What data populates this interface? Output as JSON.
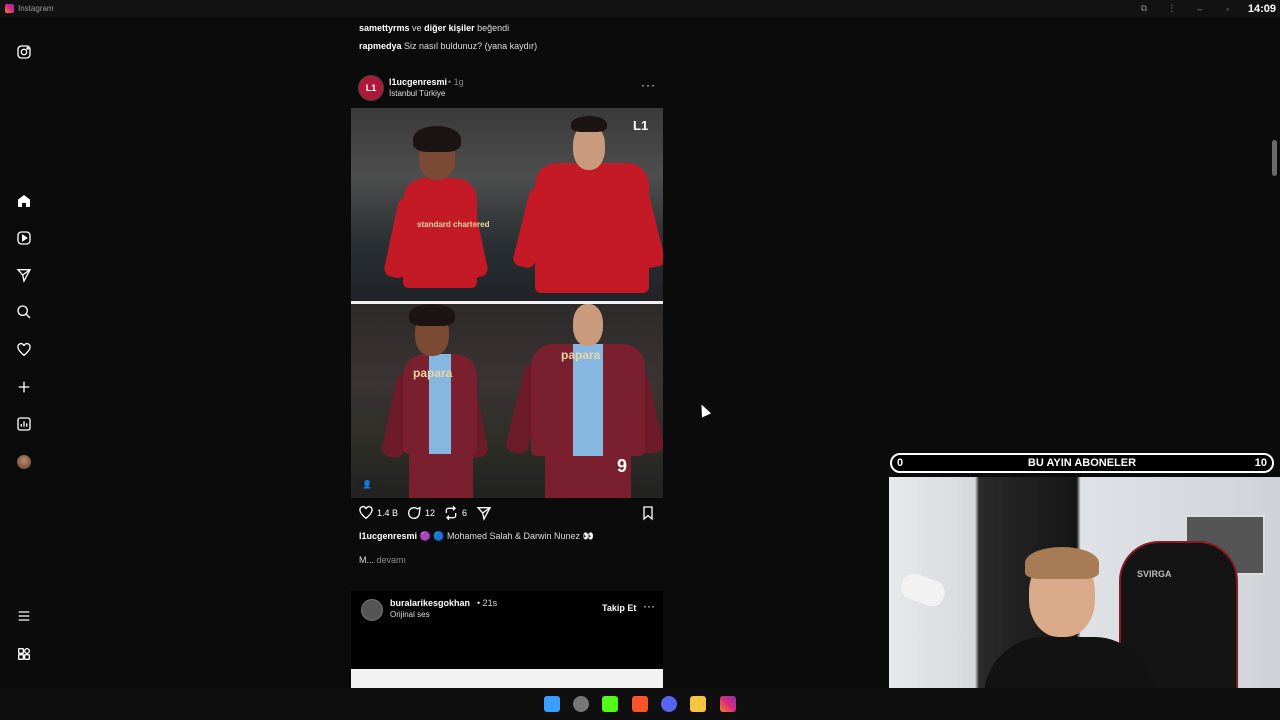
{
  "window": {
    "title": "Instagram",
    "clock": "14:09"
  },
  "feed": {
    "likes_line": {
      "user": "samettyrms",
      "connector": "ve",
      "others": "diğer kişiler",
      "verb": "beğendi"
    },
    "comment_line": {
      "user": "rapmedya",
      "text": "Siz nasıl buldunuz? (yana kaydır)"
    },
    "post": {
      "user": "l1ucgenresmi",
      "time": "1g",
      "location": "İstanbul Türkiye",
      "avatar_text": "L1",
      "image_logo": "L1",
      "sponsor_top": "standard chartered",
      "sponsor_bottom": "papara",
      "shirt_number": "9",
      "likes": "1.4 B",
      "comments": "12",
      "reposts": "6",
      "caption_user": "l1ucgenresmi",
      "caption_text": "🟣 🔵 Mohamed Salah & Darwin Nunez 👀",
      "caption_truncated": "M...",
      "more_label": "devamı"
    },
    "post2": {
      "user": "buralarikesgokhan",
      "time": "21s",
      "audio": "Orijinal ses",
      "follow_label": "Takip Et"
    }
  },
  "overlay": {
    "subs_title": "BU AYIN ABONELER",
    "subs_current": "0",
    "subs_goal": "10",
    "chair_brand": "SVIRGA"
  },
  "icons": {
    "sidebar": [
      "instagram-icon",
      "home-icon",
      "reels-icon",
      "messages-icon",
      "search-icon",
      "notifications-icon",
      "create-icon",
      "dashboard-icon",
      "profile-avatar",
      "menu-icon",
      "more-apps-icon"
    ]
  },
  "colors": {
    "background": "#0b0b0b",
    "text": "#f5f5f5",
    "liverpool_red": "#c41a25",
    "trabzon_claret": "#7a1f2e",
    "trabzon_blue": "#86b7e0"
  }
}
